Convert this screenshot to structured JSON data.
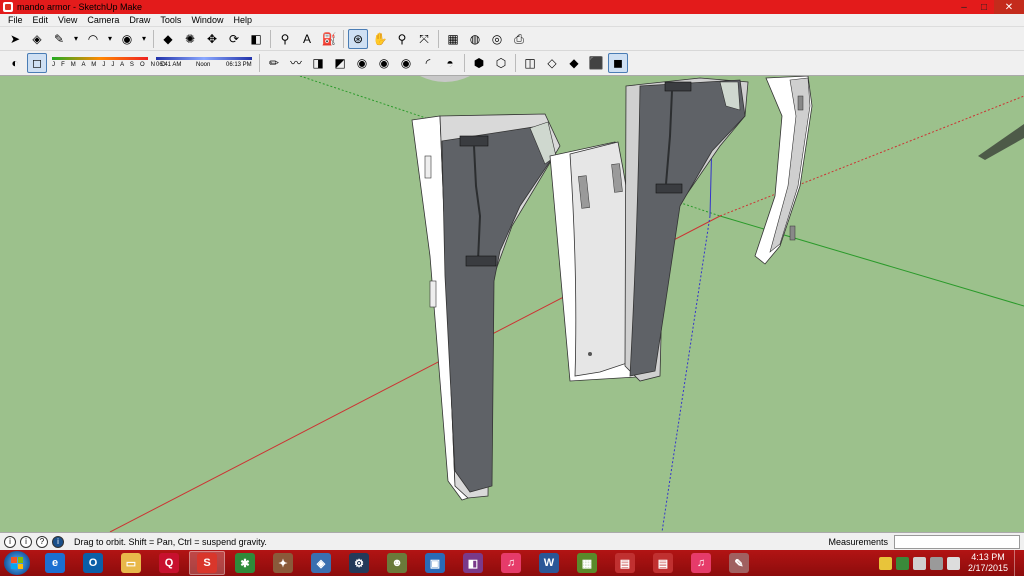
{
  "window": {
    "title": "mando armor - SketchUp Make",
    "controls": {
      "minimize": "–",
      "maximize": "□",
      "close": "✕"
    }
  },
  "menu": [
    "File",
    "Edit",
    "View",
    "Camera",
    "Draw",
    "Tools",
    "Window",
    "Help"
  ],
  "toolbar1": [
    {
      "name": "select-tool-icon",
      "glyph": "➤"
    },
    {
      "name": "eraser-tool-icon",
      "glyph": "◈"
    },
    {
      "name": "pencil-tool-icon",
      "glyph": "✎"
    },
    {
      "name": "dropdown-arrow-icon",
      "glyph": "▾",
      "small": true
    },
    {
      "name": "arc-tool-icon",
      "glyph": "◠"
    },
    {
      "name": "dropdown-arrow-icon",
      "glyph": "▾",
      "small": true
    },
    {
      "name": "circle-tool-icon",
      "glyph": "◉"
    },
    {
      "name": "dropdown-arrow-icon",
      "glyph": "▾",
      "small": true
    },
    {
      "name": "sep"
    },
    {
      "name": "push-pull-tool-icon",
      "glyph": "◆"
    },
    {
      "name": "follow-me-tool-icon",
      "glyph": "✺"
    },
    {
      "name": "move-tool-icon",
      "glyph": "✥"
    },
    {
      "name": "rotate-tool-icon",
      "glyph": "⟳"
    },
    {
      "name": "offset-tool-icon",
      "glyph": "◧"
    },
    {
      "name": "sep"
    },
    {
      "name": "tape-measure-tool-icon",
      "glyph": "⚲"
    },
    {
      "name": "text-tool-icon",
      "glyph": "A"
    },
    {
      "name": "paint-bucket-tool-icon",
      "glyph": "⛽"
    },
    {
      "name": "sep"
    },
    {
      "name": "orbit-tool-icon",
      "glyph": "⊛",
      "active": true
    },
    {
      "name": "pan-tool-icon",
      "glyph": "✋"
    },
    {
      "name": "zoom-tool-icon",
      "glyph": "⚲"
    },
    {
      "name": "zoom-extents-tool-icon",
      "glyph": "⤧"
    },
    {
      "name": "sep"
    },
    {
      "name": "warehouse-icon",
      "glyph": "▦"
    },
    {
      "name": "share-model-icon",
      "glyph": "◍"
    },
    {
      "name": "extension-warehouse-icon",
      "glyph": "◎"
    },
    {
      "name": "print-icon",
      "glyph": "⎙"
    }
  ],
  "toolbar2": [
    {
      "name": "shadows-toggle-icon",
      "glyph": "◐"
    },
    {
      "name": "fog-toggle-icon",
      "glyph": "◻",
      "active": true
    }
  ],
  "shadows": {
    "months": "J F M A M J J A S O N D",
    "time_start": "06:41 AM",
    "time_mid": "Noon",
    "time_end": "06:13 PM"
  },
  "toolbar2b": [
    {
      "name": "sandbox-draw-icon",
      "glyph": "✏"
    },
    {
      "name": "freehand-icon",
      "glyph": "〰"
    },
    {
      "name": "stamp-icon",
      "glyph": "◨"
    },
    {
      "name": "drape-icon",
      "glyph": "◩"
    },
    {
      "name": "from-contours-icon",
      "glyph": "◉"
    },
    {
      "name": "from-scratch-icon",
      "glyph": "◉"
    },
    {
      "name": "smoove-icon",
      "glyph": "◉"
    },
    {
      "name": "add-detail-icon",
      "glyph": "◜"
    },
    {
      "name": "flip-edge-icon",
      "glyph": "◓"
    },
    {
      "name": "sep"
    },
    {
      "name": "iso-view-icon",
      "glyph": "⬢"
    },
    {
      "name": "top-view-icon",
      "glyph": "⬡"
    },
    {
      "name": "sep"
    },
    {
      "name": "xray-style-icon",
      "glyph": "◫"
    },
    {
      "name": "wireframe-style-icon",
      "glyph": "◇"
    },
    {
      "name": "hidden-line-style-icon",
      "glyph": "◆"
    },
    {
      "name": "shaded-style-icon",
      "glyph": "⬛"
    },
    {
      "name": "shaded-textures-style-icon",
      "glyph": "◼",
      "active": true
    }
  ],
  "status": {
    "text": "Drag to orbit. Shift = Pan, Ctrl = suspend gravity.",
    "measurements_label": "Measurements",
    "measurements_value": "",
    "icons": [
      "i",
      "i",
      "?",
      "i"
    ]
  },
  "taskbar": {
    "apps": [
      {
        "name": "internet-explorer-icon",
        "glyph": "e",
        "color": "#1c6fd1"
      },
      {
        "name": "outlook-icon",
        "glyph": "O",
        "color": "#0b5fa8"
      },
      {
        "name": "file-explorer-icon",
        "glyph": "▭",
        "color": "#e8b84a"
      },
      {
        "name": "quicken-icon",
        "glyph": "Q",
        "color": "#c8102e"
      },
      {
        "name": "sketchup-icon",
        "glyph": "S",
        "color": "#d9362b",
        "active": true
      },
      {
        "name": "app-green-icon",
        "glyph": "✱",
        "color": "#2e8b3a"
      },
      {
        "name": "app-compass-icon",
        "glyph": "✦",
        "color": "#8a5a3a"
      },
      {
        "name": "virtualbox-icon",
        "glyph": "◈",
        "color": "#3a6fb0"
      },
      {
        "name": "steam-icon",
        "glyph": "⚙",
        "color": "#233a5a"
      },
      {
        "name": "game-icon",
        "glyph": "☻",
        "color": "#6a7a3a"
      },
      {
        "name": "box-icon",
        "glyph": "▣",
        "color": "#2a6ab8"
      },
      {
        "name": "photo-icon",
        "glyph": "◧",
        "color": "#7a3a8a"
      },
      {
        "name": "itunes-icon",
        "glyph": "♫",
        "color": "#e63b6a"
      },
      {
        "name": "word-icon",
        "glyph": "W",
        "color": "#2b5797"
      },
      {
        "name": "minecraft-icon",
        "glyph": "▦",
        "color": "#5a8a2a"
      },
      {
        "name": "app-doc-icon",
        "glyph": "▤",
        "color": "#c03030"
      },
      {
        "name": "app-doc2-icon",
        "glyph": "▤",
        "color": "#c03030"
      },
      {
        "name": "itunes2-icon",
        "glyph": "♫",
        "color": "#e63b6a"
      },
      {
        "name": "app-paint-icon",
        "glyph": "✎",
        "color": "#a06060"
      }
    ],
    "time": "4:13 PM",
    "date": "2/17/2015"
  }
}
